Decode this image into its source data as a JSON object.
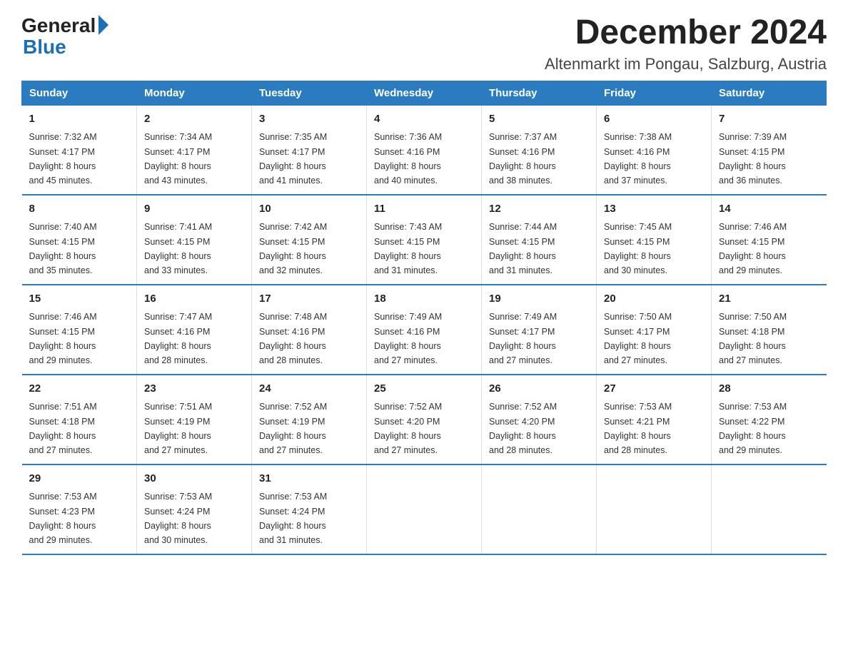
{
  "header": {
    "logo_general": "General",
    "logo_blue": "Blue",
    "title": "December 2024",
    "subtitle": "Altenmarkt im Pongau, Salzburg, Austria"
  },
  "days_of_week": [
    "Sunday",
    "Monday",
    "Tuesday",
    "Wednesday",
    "Thursday",
    "Friday",
    "Saturday"
  ],
  "weeks": [
    [
      {
        "day": "1",
        "sunrise": "7:32 AM",
        "sunset": "4:17 PM",
        "daylight": "8 hours and 45 minutes."
      },
      {
        "day": "2",
        "sunrise": "7:34 AM",
        "sunset": "4:17 PM",
        "daylight": "8 hours and 43 minutes."
      },
      {
        "day": "3",
        "sunrise": "7:35 AM",
        "sunset": "4:17 PM",
        "daylight": "8 hours and 41 minutes."
      },
      {
        "day": "4",
        "sunrise": "7:36 AM",
        "sunset": "4:16 PM",
        "daylight": "8 hours and 40 minutes."
      },
      {
        "day": "5",
        "sunrise": "7:37 AM",
        "sunset": "4:16 PM",
        "daylight": "8 hours and 38 minutes."
      },
      {
        "day": "6",
        "sunrise": "7:38 AM",
        "sunset": "4:16 PM",
        "daylight": "8 hours and 37 minutes."
      },
      {
        "day": "7",
        "sunrise": "7:39 AM",
        "sunset": "4:15 PM",
        "daylight": "8 hours and 36 minutes."
      }
    ],
    [
      {
        "day": "8",
        "sunrise": "7:40 AM",
        "sunset": "4:15 PM",
        "daylight": "8 hours and 35 minutes."
      },
      {
        "day": "9",
        "sunrise": "7:41 AM",
        "sunset": "4:15 PM",
        "daylight": "8 hours and 33 minutes."
      },
      {
        "day": "10",
        "sunrise": "7:42 AM",
        "sunset": "4:15 PM",
        "daylight": "8 hours and 32 minutes."
      },
      {
        "day": "11",
        "sunrise": "7:43 AM",
        "sunset": "4:15 PM",
        "daylight": "8 hours and 31 minutes."
      },
      {
        "day": "12",
        "sunrise": "7:44 AM",
        "sunset": "4:15 PM",
        "daylight": "8 hours and 31 minutes."
      },
      {
        "day": "13",
        "sunrise": "7:45 AM",
        "sunset": "4:15 PM",
        "daylight": "8 hours and 30 minutes."
      },
      {
        "day": "14",
        "sunrise": "7:46 AM",
        "sunset": "4:15 PM",
        "daylight": "8 hours and 29 minutes."
      }
    ],
    [
      {
        "day": "15",
        "sunrise": "7:46 AM",
        "sunset": "4:15 PM",
        "daylight": "8 hours and 29 minutes."
      },
      {
        "day": "16",
        "sunrise": "7:47 AM",
        "sunset": "4:16 PM",
        "daylight": "8 hours and 28 minutes."
      },
      {
        "day": "17",
        "sunrise": "7:48 AM",
        "sunset": "4:16 PM",
        "daylight": "8 hours and 28 minutes."
      },
      {
        "day": "18",
        "sunrise": "7:49 AM",
        "sunset": "4:16 PM",
        "daylight": "8 hours and 27 minutes."
      },
      {
        "day": "19",
        "sunrise": "7:49 AM",
        "sunset": "4:17 PM",
        "daylight": "8 hours and 27 minutes."
      },
      {
        "day": "20",
        "sunrise": "7:50 AM",
        "sunset": "4:17 PM",
        "daylight": "8 hours and 27 minutes."
      },
      {
        "day": "21",
        "sunrise": "7:50 AM",
        "sunset": "4:18 PM",
        "daylight": "8 hours and 27 minutes."
      }
    ],
    [
      {
        "day": "22",
        "sunrise": "7:51 AM",
        "sunset": "4:18 PM",
        "daylight": "8 hours and 27 minutes."
      },
      {
        "day": "23",
        "sunrise": "7:51 AM",
        "sunset": "4:19 PM",
        "daylight": "8 hours and 27 minutes."
      },
      {
        "day": "24",
        "sunrise": "7:52 AM",
        "sunset": "4:19 PM",
        "daylight": "8 hours and 27 minutes."
      },
      {
        "day": "25",
        "sunrise": "7:52 AM",
        "sunset": "4:20 PM",
        "daylight": "8 hours and 27 minutes."
      },
      {
        "day": "26",
        "sunrise": "7:52 AM",
        "sunset": "4:20 PM",
        "daylight": "8 hours and 28 minutes."
      },
      {
        "day": "27",
        "sunrise": "7:53 AM",
        "sunset": "4:21 PM",
        "daylight": "8 hours and 28 minutes."
      },
      {
        "day": "28",
        "sunrise": "7:53 AM",
        "sunset": "4:22 PM",
        "daylight": "8 hours and 29 minutes."
      }
    ],
    [
      {
        "day": "29",
        "sunrise": "7:53 AM",
        "sunset": "4:23 PM",
        "daylight": "8 hours and 29 minutes."
      },
      {
        "day": "30",
        "sunrise": "7:53 AM",
        "sunset": "4:24 PM",
        "daylight": "8 hours and 30 minutes."
      },
      {
        "day": "31",
        "sunrise": "7:53 AM",
        "sunset": "4:24 PM",
        "daylight": "8 hours and 31 minutes."
      },
      null,
      null,
      null,
      null
    ]
  ],
  "labels": {
    "sunrise": "Sunrise:",
    "sunset": "Sunset:",
    "daylight": "Daylight:"
  },
  "colors": {
    "header_bg": "#2a7bbf",
    "header_text": "#ffffff",
    "border": "#2a7bbf"
  }
}
